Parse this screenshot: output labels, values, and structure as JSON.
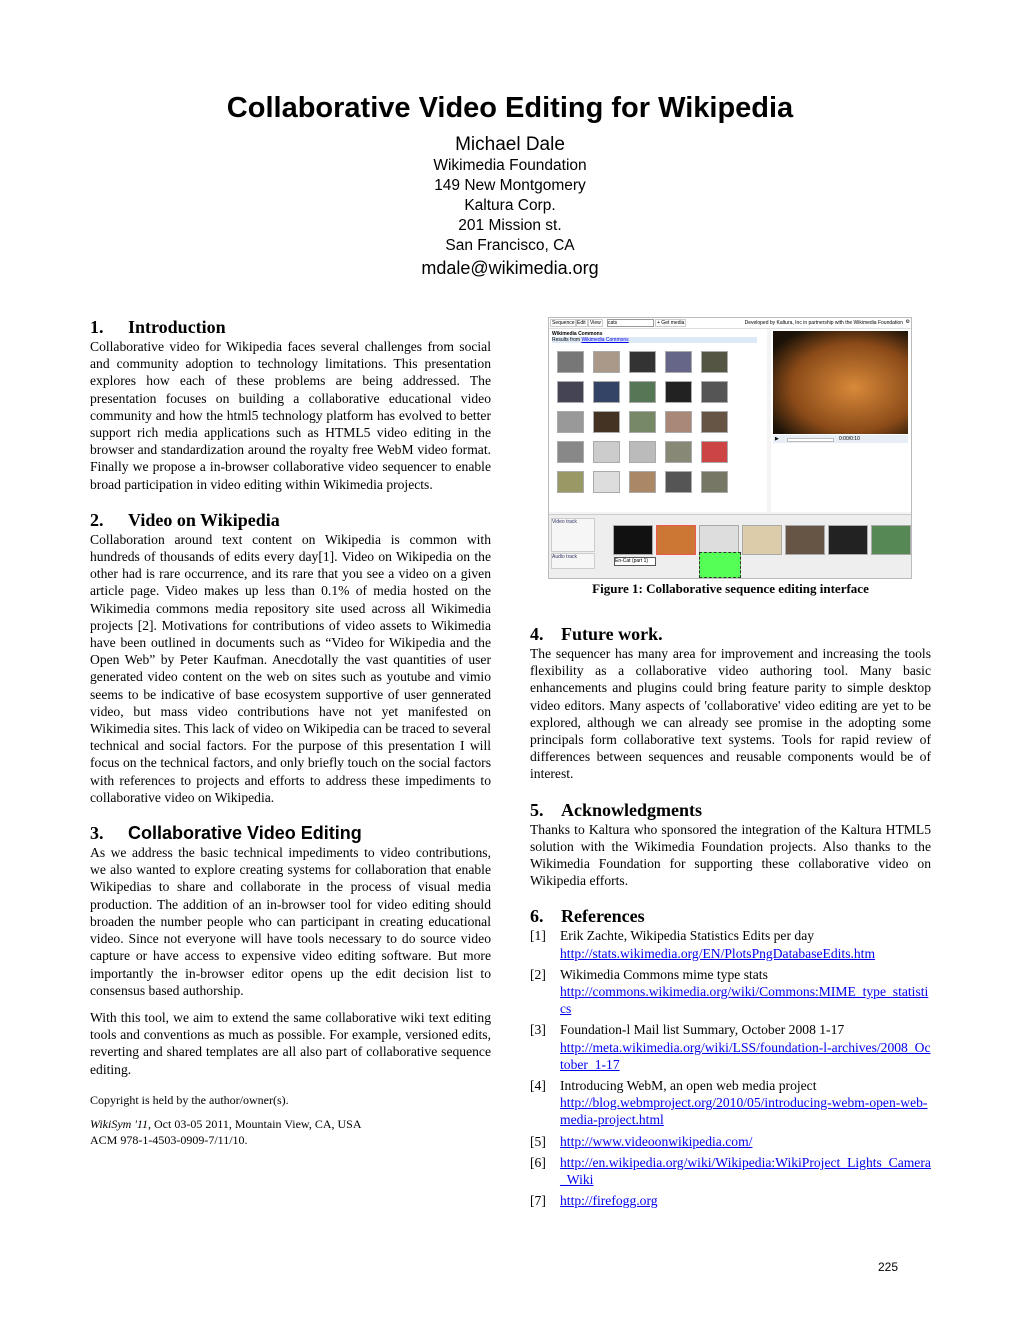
{
  "title": "Collaborative Video Editing for Wikipedia",
  "author": {
    "name": "Michael Dale",
    "affiliations": [
      "Wikimedia Foundation",
      "149 New Montgomery",
      "Kaltura Corp.",
      "201 Mission st.",
      "San Francisco, CA"
    ],
    "email": "mdale@wikimedia.org"
  },
  "sections": [
    {
      "num": "1.",
      "title": "Introduction",
      "paragraphs": [
        "Collaborative video for Wikipedia faces several challenges from social and community adoption to technology limitations. This presentation explores how each of these problems are being addressed. The presentation focuses on building a collaborative educational video community and how the html5 technology platform has evolved to better support rich media applications such as HTML5 video editing in the browser and standardization around the royalty free WebM video format. Finally we propose a in-browser collaborative video sequencer to enable broad participation in video editing within Wikimedia projects."
      ]
    },
    {
      "num": "2.",
      "title": "Video on Wikipedia",
      "paragraphs": [
        "Collaboration around text content on Wikipedia is common with hundreds of thousands of edits every day[1]. Video on Wikipedia on the other had is rare occurrence, and its rare that you see a video on a given article page. Video makes up less than 0.1% of media hosted on the Wikimedia commons media repository site used across all Wikimedia projects [2]. Motivations for contributions of video assets to Wikimedia have been outlined in documents such as “Video for Wikipedia and the Open Web” by Peter Kaufman. Anecdotally the vast quantities of user generated video content on the web on sites such as youtube and vimio seems to be indicative of base ecosystem supportive of user gennerated video, but mass video contributions have not yet manifested on Wikimedia sites. This lack of video on Wikipedia can be traced to several technical and social factors. For the purpose of this presentation I will focus on the technical factors, and only briefly touch on the social factors with references to projects and efforts to address these impediments to collaborative video on Wikipedia."
      ]
    },
    {
      "num": "3.",
      "title": "Collaborative Video  Editing",
      "paragraphs": [
        "As we address the basic technical impediments to video contributions, we also wanted to explore creating systems for collaboration that enable Wikipedias to share and collaborate in the process of visual media production. The addition of an in-browser tool for video editing should broaden the number people who can participant in creating educational video. Since not everyone will have tools necessary to do source video capture or have access to expensive video editing software. But more importantly the in-browser editor opens up the edit decision list to consensus based authorship.",
        "With this tool, we aim to extend the same collaborative wiki text editing tools and conventions as much as possible. For example, versioned edits, reverting and shared templates are all also part of collaborative sequence editing."
      ]
    },
    {
      "num": "4.",
      "title": "Future work.",
      "paragraphs": [
        "The sequencer has many area for improvement and increasing the tools flexibility as a collaborative video authoring tool. Many basic enhancements and plugins could bring feature parity to simple desktop video editors. Many aspects of 'collaborative' video editing are yet to be explored, although we can already see promise in the adopting some principals form collaborative text systems. Tools for rapid review of differences between sequences and reusable components would be of interest."
      ]
    },
    {
      "num": "5.",
      "title": "Acknowledgments",
      "paragraphs": [
        "Thanks to Kaltura who sponsored the integration of the Kaltura HTML5 solution with the Wikimedia Foundation projects. Also thanks to the Wikimedia Foundation for supporting these collaborative video on Wikipedia efforts."
      ]
    },
    {
      "num": "6.",
      "title": "References"
    }
  ],
  "references": [
    {
      "n": "[1]",
      "text": "Erik Zachte, Wikipedia Statistics Edits per day",
      "url": "http://stats.wikimedia.org/EN/PlotsPngDatabaseEdits.htm"
    },
    {
      "n": "[2]",
      "text": "Wikimedia Commons mime type stats",
      "url": "http://commons.wikimedia.org/wiki/Commons:MIME_type_statistics"
    },
    {
      "n": "[3]",
      "text": "Foundation-l Mail list Summary, October 2008  1-17",
      "url": "http://meta.wikimedia.org/wiki/LSS/foundation-l-archives/2008_October_1-17"
    },
    {
      "n": "[4]",
      "text": "Introducing WebM, an open web media project",
      "url": "http://blog.webmproject.org/2010/05/introducing-webm-open-web-media-project.html"
    },
    {
      "n": "[5]",
      "text": "",
      "url": "http://www.videoonwikipedia.com/"
    },
    {
      "n": "[6]",
      "text": "",
      "url": "http://en.wikipedia.org/wiki/Wikipedia:WikiProject_Lights_Camera_Wiki"
    },
    {
      "n": "[7]",
      "text": "",
      "url": "http://firefogg.org"
    }
  ],
  "copyright": "Copyright is held by the author/owner(s).",
  "venue": {
    "conf": "WikiSym '11",
    "rest": ", Oct 03-05 2011, Mountain View, CA, USA",
    "acm": "ACM 978-1-4503-0909-7/11/10."
  },
  "figure": {
    "caption": "Figure 1: Collaborative sequence editing interface",
    "menu": [
      "Sequence",
      "Edit",
      "View"
    ],
    "search_value": "cats",
    "get_media": "+ Get media",
    "credit": "Developed by Kaltura, Inc in partnership with the Wikimedia Foundation",
    "source_heading": "Wikimedia Commons",
    "results_text": "Results from",
    "results_link": "Wikimedia Commons",
    "time": "0:00/0:10",
    "video_track": "Video track",
    "audio_track": "Audio track",
    "clip_label": "En-Cat (part 1)"
  },
  "page_number": "225"
}
